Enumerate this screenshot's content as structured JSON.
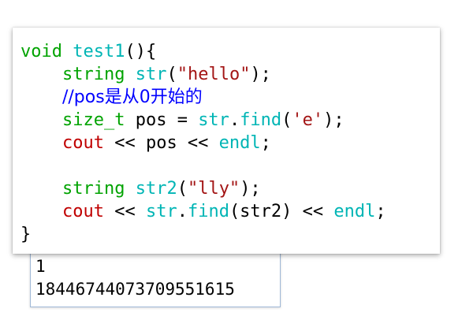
{
  "colors": {
    "keyword": "#00a300",
    "function": "#00b5b5",
    "string": "#a31515",
    "stream": "#c00000",
    "comment": "#0000ff"
  },
  "code": {
    "line1": {
      "kw": "void",
      "sp": " ",
      "fn": "test1",
      "punct": "(){"
    },
    "line2": {
      "indent": "    ",
      "kw": "string",
      "sp": " ",
      "fn": "str",
      "open": "(",
      "str": "\"hello\"",
      "close": ");"
    },
    "line3": {
      "indent": "    ",
      "comment": "//pos是从0开始的"
    },
    "line4": {
      "indent": "    ",
      "kw": "size_t",
      "var": " pos = ",
      "fn1": "str",
      "dot": ".",
      "fn2": "find",
      "open": "(",
      "str": "'e'",
      "close": ");"
    },
    "line5": {
      "indent": "    ",
      "out": "cout",
      "mid": " << pos << ",
      "fn": "endl",
      "end": ";"
    },
    "line7": {
      "indent": "    ",
      "kw": "string",
      "sp": " ",
      "fn": "str2",
      "open": "(",
      "str": "\"lly\"",
      "close": ");"
    },
    "line8": {
      "indent": "    ",
      "out": "cout",
      "op": " << ",
      "fn1": "str",
      "dot": ".",
      "fn2": "find",
      "arg": "(str2) << ",
      "fn3": "endl",
      "end": ";"
    },
    "line9": {
      "punct": "}"
    }
  },
  "console": {
    "lines": [
      "1",
      "18446744073709551615"
    ]
  }
}
